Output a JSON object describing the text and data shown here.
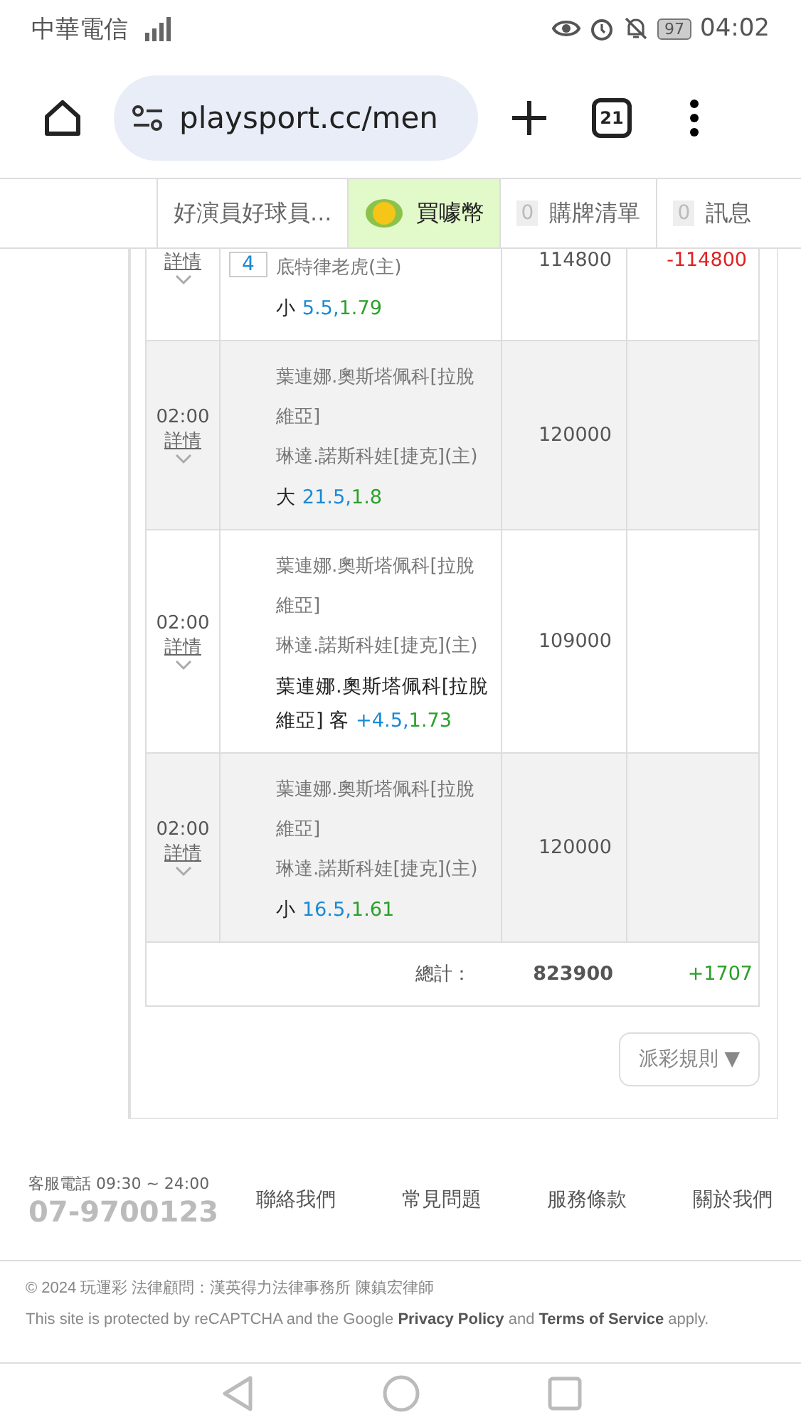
{
  "status_bar": {
    "carrier": "中華電信",
    "battery": "97",
    "time": "04:02"
  },
  "browser": {
    "url": "playsport.cc/men",
    "tab_count": "21"
  },
  "nav_tabs": [
    {
      "kind": "text",
      "label": "好演員好球員...",
      "selected": false
    },
    {
      "kind": "coin",
      "label": "買噱幣",
      "selected": true
    },
    {
      "kind": "count",
      "count": "0",
      "label": "購牌清單",
      "selected": false
    },
    {
      "kind": "count",
      "count": "0",
      "label": "訊息",
      "selected": false
    }
  ],
  "bets": [
    {
      "detail": "詳情",
      "badge": "4",
      "teams": [
        "底特律老虎(主)"
      ],
      "pick": {
        "label": "小",
        "line": "5.5,",
        "odds": "1.79"
      },
      "amount": "114800",
      "result": "-114800"
    },
    {
      "time": "02:00",
      "detail": "詳情",
      "teams": [
        "葉連娜.奧斯塔佩科[拉脫維亞]",
        "琳達.諾斯科娃[捷克](主)"
      ],
      "pick": {
        "label": "大",
        "line": "21.5,",
        "odds": "1.8"
      },
      "amount": "120000"
    },
    {
      "time": "02:00",
      "detail": "詳情",
      "teams": [
        "葉連娜.奧斯塔佩科[拉脫維亞]",
        "琳達.諾斯科娃[捷克](主)"
      ],
      "pick": {
        "label": "葉連娜.奧斯塔佩科[拉脫維亞] 客",
        "line": "+4.5,",
        "odds": "1.73"
      },
      "amount": "109000"
    },
    {
      "time": "02:00",
      "detail": "詳情",
      "teams": [
        "葉連娜.奧斯塔佩科[拉脫維亞]",
        "琳達.諾斯科娃[捷克](主)"
      ],
      "pick": {
        "label": "小",
        "line": "16.5,",
        "odds": "1.61"
      },
      "amount": "120000"
    }
  ],
  "total": {
    "label": "總計：",
    "amount": "823900",
    "result": "+1707"
  },
  "rules_button": "派彩規則 ▼",
  "footer": {
    "hours": "客服電話 09:30 ~ 24:00",
    "phone": "07-9700123",
    "links": [
      "聯絡我們",
      "常見問題",
      "服務條款",
      "關於我們"
    ],
    "copyright": "© 2024 玩運彩 法律顧問：漢英得力法律事務所 陳鎮宏律師",
    "recaptcha": "This site is protected by reCAPTCHA and the Google **Privacy Policy** and **Terms of Service** apply."
  }
}
